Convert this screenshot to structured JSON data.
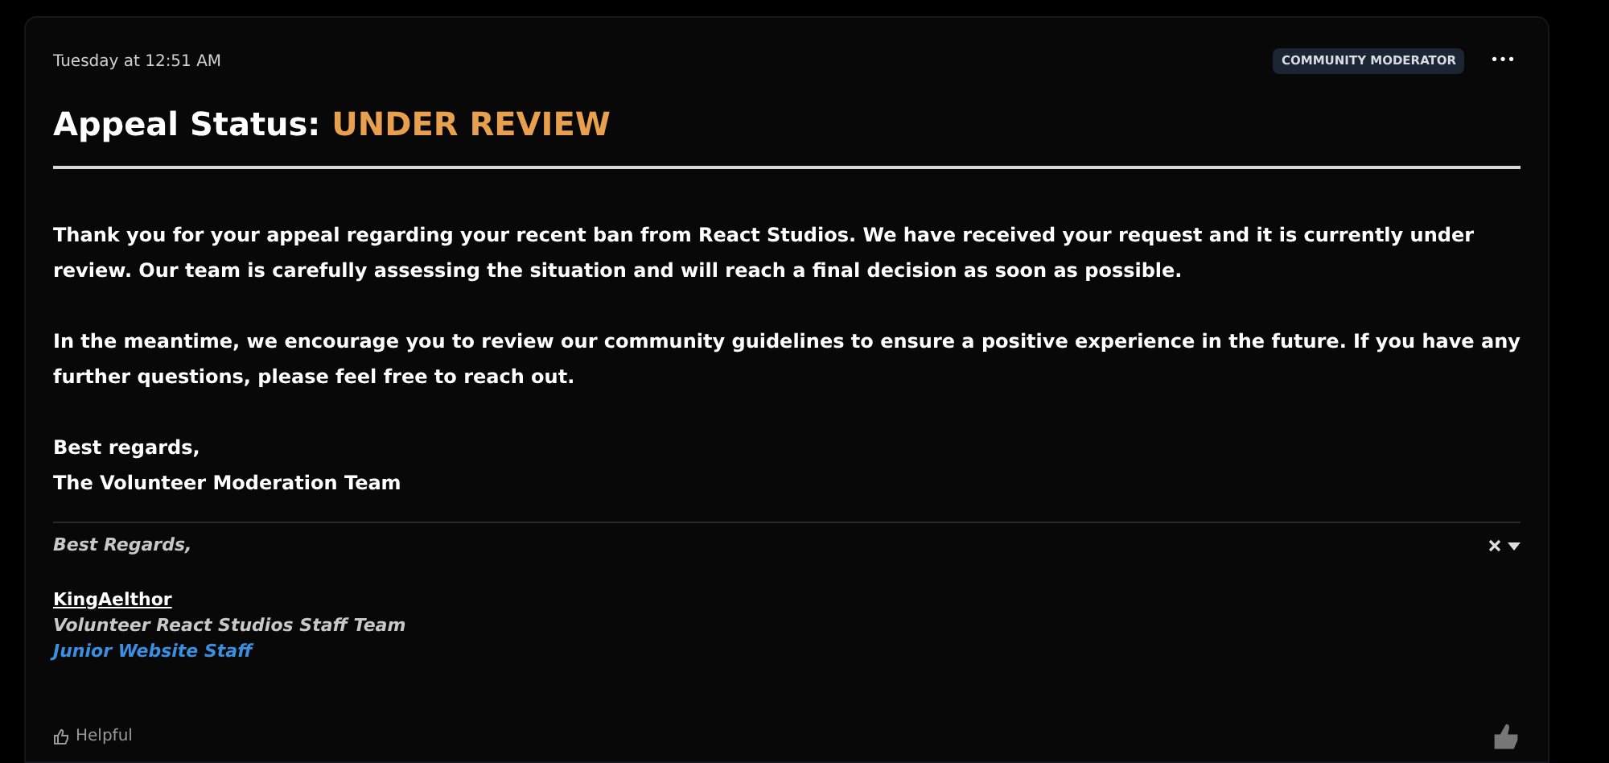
{
  "post": {
    "timestamp": "Tuesday at 12:51 AM",
    "badge": "COMMUNITY MODERATOR",
    "menu": "•••",
    "title": {
      "prefix": "Appeal Status:",
      "status": "UNDER REVIEW"
    },
    "paragraphs": [
      "Thank you for your appeal regarding your recent ban from React Studios. We have received your request and it is currently under review. Our team is carefully assessing the situation and will reach a final decision as soon as possible.",
      "In the meantime, we encourage you to review our community guidelines to ensure a positive experience in the future. If you have any further questions, please feel free to reach out."
    ],
    "closing": [
      "Best regards,",
      "The Volunteer Moderation Team"
    ]
  },
  "signature": {
    "greeting": "Best Regards,",
    "name": "KingAelthor",
    "team": "Volunteer React Studios Staff Team",
    "role": "Junior Website Staff"
  },
  "footer": {
    "reaction": "Helpful"
  }
}
